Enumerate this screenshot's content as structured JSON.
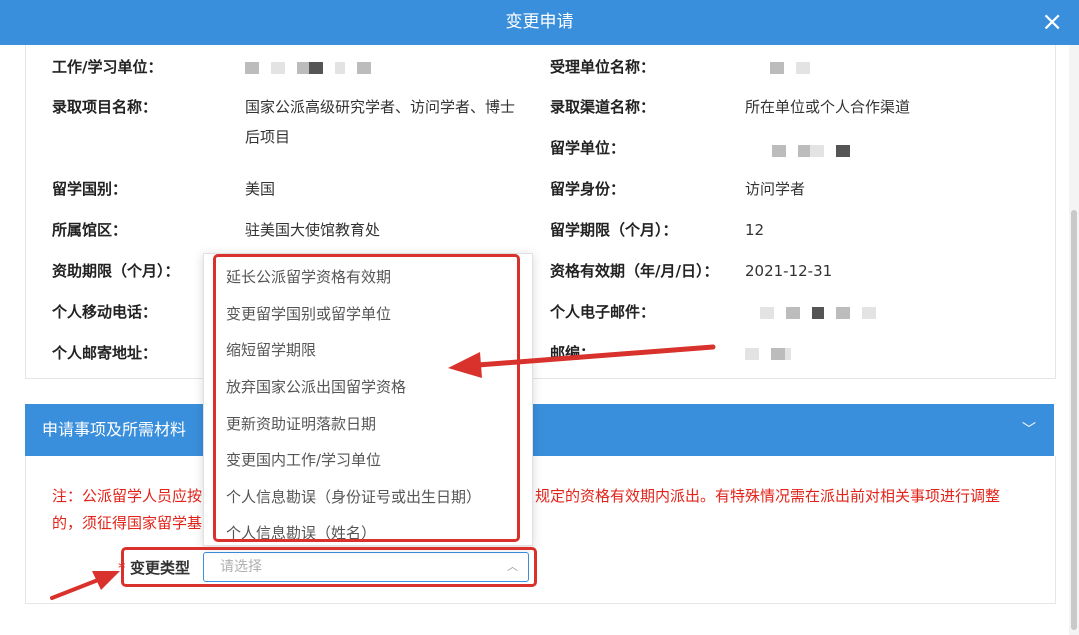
{
  "dialog": {
    "title": "变更申请",
    "close_icon": "×"
  },
  "fields": {
    "work_unit": {
      "label": "工作/学习单位："
    },
    "accept_unit": {
      "label": "受理单位名称："
    },
    "project_name": {
      "label": "录取项目名称：",
      "value_line1": "国家公派高级研究学者、访问学者、博士",
      "value_line2": "后项目"
    },
    "channel_name": {
      "label": "录取渠道名称：",
      "value": "所在单位或个人合作渠道"
    },
    "study_unit": {
      "label": "留学单位："
    },
    "country": {
      "label": "留学国别：",
      "value": "美国"
    },
    "identity": {
      "label": "留学身份：",
      "value": "访问学者"
    },
    "consulate": {
      "label": "所属馆区：",
      "value": "驻美国大使馆教育处"
    },
    "study_period": {
      "label": "留学期限（个月）：",
      "value": "12"
    },
    "fund_period": {
      "label": "资助期限（个月）："
    },
    "validity": {
      "label": "资格有效期（年/月/日）：",
      "value": "2021-12-31"
    },
    "mobile": {
      "label": "个人移动电话："
    },
    "email": {
      "label": "个人电子邮件："
    },
    "address": {
      "label": "个人邮寄地址："
    },
    "postcode": {
      "label": "邮编："
    }
  },
  "section": {
    "title": "申请事项及所需材料",
    "chevron": "﹀"
  },
  "note": {
    "line1_left": "注：公派留学人员应按",
    "line1_right": "规定的资格有效期内派出。有特殊情况需在派出前对相关事项进行调整",
    "line2_left": "的，须征得国家留学基"
  },
  "change_type": {
    "required_mark": "*",
    "label": "变更类型",
    "placeholder": "请选择",
    "arrow": "︿",
    "options": [
      "延长公派留学资格有效期",
      "变更留学国别或留学单位",
      "缩短留学期限",
      "放弃国家公派出国留学资格",
      "更新资助证明落款日期",
      "变更国内工作/学习单位",
      "个人信息勘误（身份证号或出生日期）",
      "个人信息勘误（姓名）"
    ]
  },
  "colors": {
    "header": "#3a8fdc",
    "highlight": "#d9312b",
    "note": "#e2231a"
  }
}
